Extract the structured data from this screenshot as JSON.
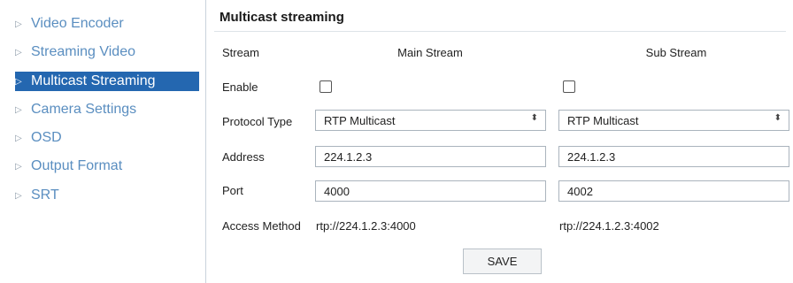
{
  "sidebar": {
    "items": [
      {
        "label": "Video Encoder",
        "arrow": "▷"
      },
      {
        "label": "Streaming Video",
        "arrow": "▷"
      },
      {
        "label": "Multicast Streaming",
        "arrow": "▷",
        "active": true
      },
      {
        "label": "Camera Settings",
        "arrow": "▷"
      },
      {
        "label": "OSD",
        "arrow": "▷"
      },
      {
        "label": "Output Format",
        "arrow": "▷"
      },
      {
        "label": "SRT",
        "arrow": "▷"
      }
    ]
  },
  "main": {
    "title": "Multicast streaming",
    "labels": {
      "stream": "Stream",
      "enable": "Enable",
      "protocol_type": "Protocol Type",
      "address": "Address",
      "port": "Port",
      "access_method": "Access Method"
    },
    "main_stream": {
      "header": "Main Stream",
      "enabled": false,
      "protocol": "RTP Multicast",
      "address": "224.1.2.3",
      "port": "4000",
      "access_url": "rtp://224.1.2.3:4000"
    },
    "sub_stream": {
      "header": "Sub Stream",
      "enabled": false,
      "protocol": "RTP Multicast",
      "address": "224.1.2.3",
      "port": "4002",
      "access_url": "rtp://224.1.2.3:4002"
    },
    "save_label": "SAVE",
    "caret_glyph": "⬍"
  },
  "colors": {
    "sidebar_active_bg": "#2467b0",
    "sidebar_link": "#5a8ec0"
  }
}
